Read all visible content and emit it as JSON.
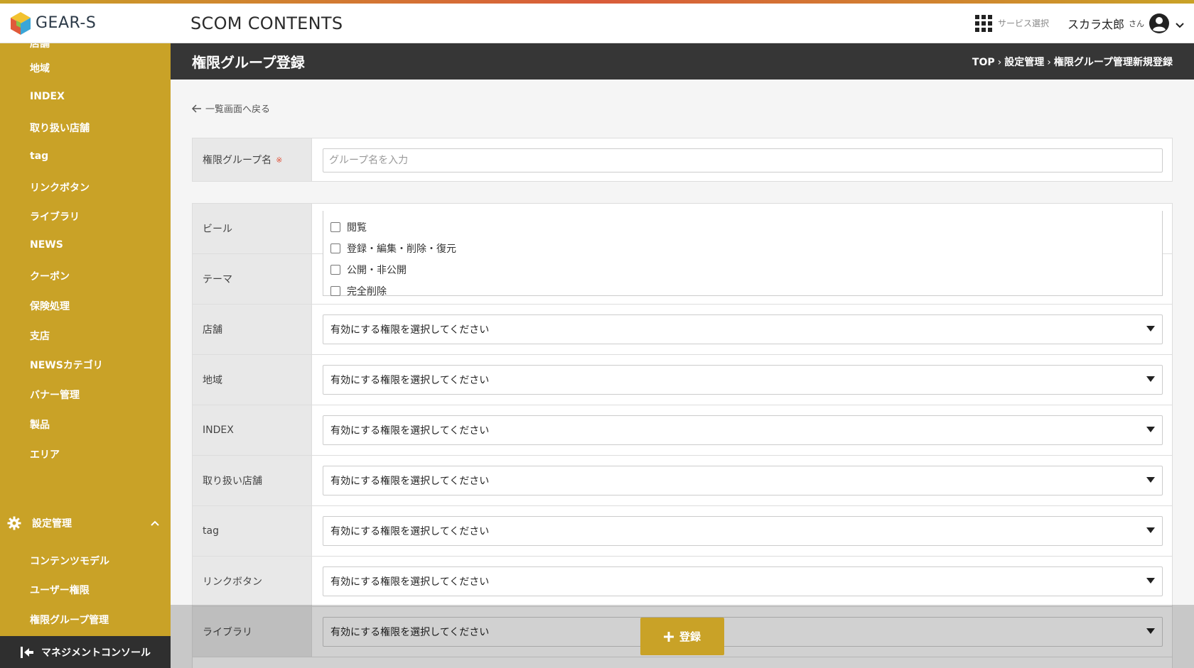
{
  "header": {
    "logo_text": "GEAR-S",
    "app_title": "SCOM CONTENTS",
    "service_label": "サービス選択",
    "user_name": "スカラ太郎",
    "user_suffix": "さん"
  },
  "sidebar": {
    "cut_item": "店舗",
    "items": [
      {
        "label": "地域"
      },
      {
        "label": "INDEX"
      },
      {
        "label": "取り扱い店舗"
      },
      {
        "label": "tag"
      },
      {
        "label": "リンクボタン"
      },
      {
        "label": "ライブラリ"
      },
      {
        "label": "NEWS"
      },
      {
        "label": "クーポン"
      },
      {
        "label": "保険処理"
      },
      {
        "label": "支店"
      },
      {
        "label": "NEWSカテゴリ"
      },
      {
        "label": "バナー管理"
      },
      {
        "label": "製品"
      },
      {
        "label": "エリア"
      }
    ],
    "section": {
      "label": "設定管理"
    },
    "sub_items": [
      {
        "label": "コンテンツモデル"
      },
      {
        "label": "ユーザー権限"
      },
      {
        "label": "権限グループ管理"
      }
    ],
    "bottom_label": "マネジメントコンソール"
  },
  "page": {
    "title": "権限グループ登録",
    "breadcrumb": [
      "TOP",
      "設定管理",
      "権限グループ管理新規登録"
    ],
    "back_label": "一覧画面へ戻る"
  },
  "form": {
    "group_name_label": "権限グループ名",
    "required_mark": "※",
    "group_name_placeholder": "グループ名を入力",
    "group_name_value": ""
  },
  "permissions": {
    "select_placeholder": "有効にする権限を選択してください",
    "rows": [
      {
        "label": "ビール"
      },
      {
        "label": "テーマ"
      },
      {
        "label": "店舗"
      },
      {
        "label": "地域"
      },
      {
        "label": "INDEX"
      },
      {
        "label": "取り扱い店舗"
      },
      {
        "label": "tag"
      },
      {
        "label": "リンクボタン"
      },
      {
        "label": "ライブラリ"
      }
    ],
    "dropdown_options": [
      {
        "label": "閲覧"
      },
      {
        "label": "登録・編集・削除・復元"
      },
      {
        "label": "公開・非公開"
      },
      {
        "label": "完全削除"
      }
    ]
  },
  "actions": {
    "submit_label": "登録"
  }
}
